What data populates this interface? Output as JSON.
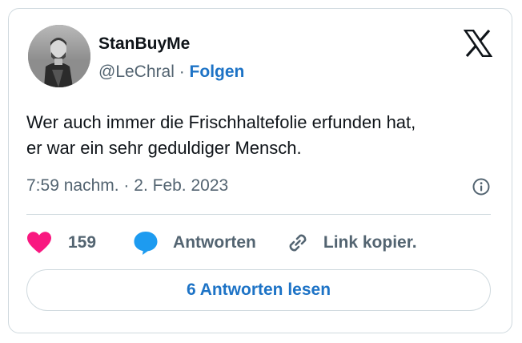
{
  "author": {
    "display_name": "StanBuyMe",
    "handle": "@LeChral",
    "separator": "·",
    "follow_label": "Folgen"
  },
  "tweet": {
    "text_lines": [
      "Wer auch immer die Frischhaltefolie erfunden hat,",
      "er war ein sehr geduldiger Mensch."
    ],
    "time": "7:59 nachm.",
    "date_separator": "·",
    "date": "2. Feb. 2023"
  },
  "actions": {
    "like_count": "159",
    "reply_label": "Antworten",
    "copy_link_label": "Link kopier."
  },
  "read_replies_label": "6 Antworten lesen",
  "icons": {
    "brand": "x-logo-icon",
    "info": "info-icon",
    "like": "heart-icon",
    "reply": "speech-bubble-icon",
    "link": "link-icon"
  },
  "colors": {
    "link_blue": "#1d73c6",
    "heart_pink": "#f91880",
    "reply_blue": "#1d9bf0",
    "secondary_text": "#536471",
    "border": "#cfd9de"
  }
}
